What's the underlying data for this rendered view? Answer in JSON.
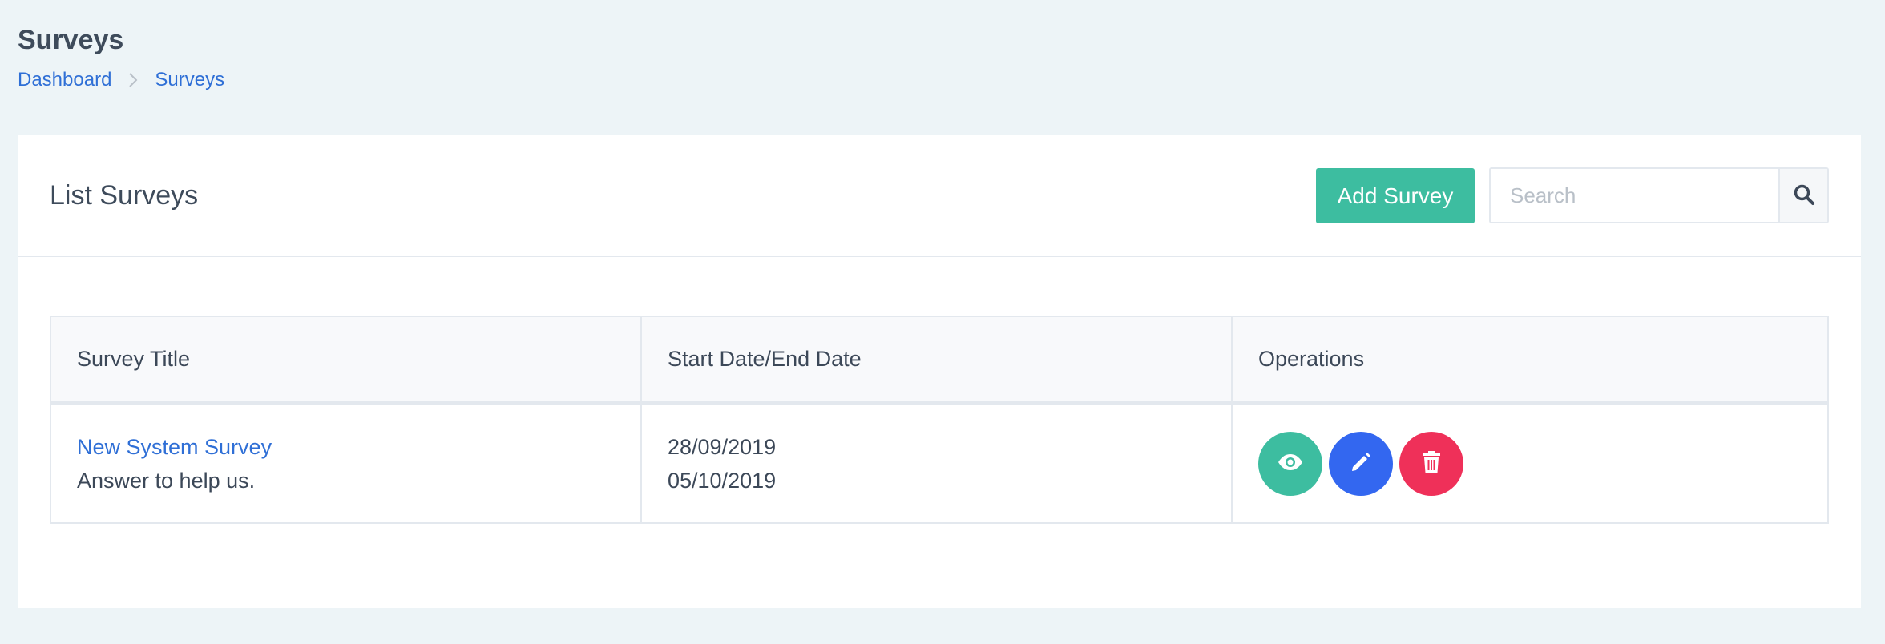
{
  "page": {
    "title": "Surveys"
  },
  "breadcrumb": {
    "items": [
      {
        "label": "Dashboard"
      },
      {
        "label": "Surveys"
      }
    ]
  },
  "card": {
    "title": "List Surveys",
    "add_button_label": "Add Survey",
    "search": {
      "placeholder": "Search",
      "value": ""
    }
  },
  "table": {
    "columns": [
      "Survey Title",
      "Start Date/End Date",
      "Operations"
    ],
    "rows": [
      {
        "title": "New System Survey",
        "description": "Answer to help us.",
        "start_date": "28/09/2019",
        "end_date": "05/10/2019",
        "operations": [
          "eye-icon",
          "pencil-icon",
          "trash-icon"
        ]
      }
    ]
  },
  "colors": {
    "accent_green": "#3dbda0",
    "accent_blue": "#3367f0",
    "accent_red": "#ef3059",
    "link": "#2f6fd6",
    "background": "#edf4f7"
  }
}
